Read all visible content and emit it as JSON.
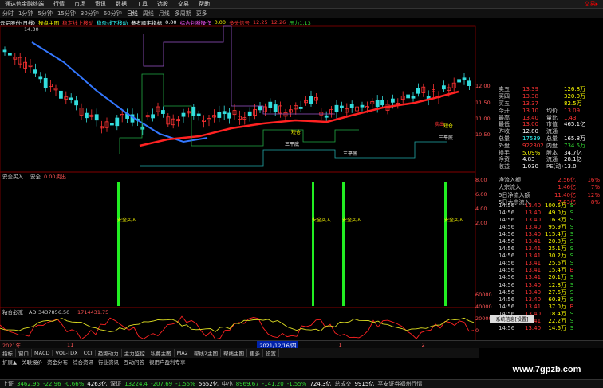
{
  "menu": {
    "items": [
      "通达信金融终端",
      "行情",
      "市场",
      "资讯",
      "数据",
      "工具",
      "选股",
      "交易",
      "帮助"
    ],
    "title": "交易▸"
  },
  "toolbar": {
    "items": [
      "分时",
      "1分钟",
      "5分钟",
      "15分钟",
      "30分钟",
      "60分钟",
      "日线",
      "周线",
      "月线",
      "多周期",
      "更多"
    ],
    "active": "日线"
  },
  "info": {
    "stock": "云铝股份(日线)",
    "indicator": "操盘主图",
    "t1": "稳定线上移动",
    "t2": "稳盈线下移动",
    "t3": "参考顺宅指标",
    "t3v": "0.00",
    "t4": "综合判断操作",
    "t5": "0.00",
    "t6": "多头信号",
    "t7": "12.25",
    "t8": "12.26",
    "t9": "压力1.13"
  },
  "price_axis": [
    "12.00",
    "11.50",
    "11.00",
    "10.50"
  ],
  "panel2": {
    "title": "安全买入",
    "label": "安全",
    "val": "0.00",
    "extra": "卖出",
    "axis": [
      "8.00",
      "6.00",
      "4.00",
      "2.00",
      "0.00"
    ],
    "buy_label": "安全买入"
  },
  "panel3": {
    "title": "粘合必涨",
    "ad": "AD",
    "ad_val": "3437856.50",
    "v2": "1714431.75",
    "axis": [
      "60000",
      "40000",
      "20000",
      "0",
      "-20000"
    ]
  },
  "quote": {
    "rows": [
      [
        "卖五",
        "13.39",
        "",
        "126.8万",
        ""
      ],
      [
        "买四",
        "13.38",
        "",
        "320.0万",
        ""
      ],
      [
        "买五",
        "13.37",
        "",
        "82.5万",
        ""
      ],
      [
        "今开",
        "13.10",
        "均价",
        "13.09",
        ""
      ],
      [
        "最高",
        "13.40",
        "量比",
        "1.43",
        ""
      ],
      [
        "最低",
        "13.00",
        "市值",
        "465.1亿",
        ""
      ],
      [
        "昨收",
        "12.80",
        "流通",
        "",
        ""
      ],
      [
        "总量",
        "17539",
        "总量",
        "165.8万",
        ""
      ],
      [
        "外盘",
        "922302",
        "内盘",
        "734.5万",
        ""
      ],
      [
        "换手",
        "5.09%",
        "股本",
        "34.7亿",
        ""
      ],
      [
        "净资",
        "4.83",
        "流通",
        "28.1亿",
        ""
      ],
      [
        "收益",
        "1.030",
        "PE(动)",
        "13.0",
        ""
      ]
    ]
  },
  "fund": [
    [
      "净流入额",
      "2.56亿",
      "16%"
    ],
    [
      "大宗流入",
      "1.46亿",
      "7%"
    ],
    [
      "5日净流入额",
      "11.40亿",
      "12%"
    ],
    [
      "5日大宗流入",
      "7.83亿",
      "8%"
    ]
  ],
  "ticks": [
    [
      "14:56",
      "13.40",
      "100.6万",
      "S"
    ],
    [
      "14:56",
      "13.40",
      "49.0万",
      "S"
    ],
    [
      "14:56",
      "13.40",
      "16.3万",
      "S"
    ],
    [
      "14:56",
      "13.40",
      "95.9万",
      "S"
    ],
    [
      "14:56",
      "13.40",
      "115.4万",
      "S"
    ],
    [
      "14:56",
      "13.41",
      "20.8万",
      "S"
    ],
    [
      "14:56",
      "13.41",
      "25.1万",
      "S"
    ],
    [
      "14:56",
      "13.41",
      "30.2万",
      "S"
    ],
    [
      "14:56",
      "13.41",
      "25.6万",
      "S"
    ],
    [
      "14:56",
      "13.41",
      "15.4万",
      "B"
    ],
    [
      "14:56",
      "13.41",
      "20.1万",
      "S"
    ],
    [
      "14:56",
      "13.40",
      "12.8万",
      "S"
    ],
    [
      "14:56",
      "13.40",
      "27.6万",
      "S"
    ],
    [
      "14:56",
      "13.40",
      "60.3万",
      "S"
    ],
    [
      "14:56",
      "13.41",
      "37.0万",
      "B"
    ],
    [
      "14:56",
      "13.40",
      "18.4万",
      "S"
    ],
    [
      "14:56",
      "13.41",
      "22.2万",
      "S"
    ],
    [
      "14:56",
      "13.40",
      "14.6万",
      "S"
    ]
  ],
  "xaxis": {
    "year": "2021年",
    "m1": "11",
    "date_box": "2021/12/16/四",
    "m2": "1",
    "m3": "2"
  },
  "tabs": [
    "指标",
    "窗口",
    "MACD",
    "VOL-TDX",
    "CCI",
    "趋势动力",
    "主力监控",
    "私募主图",
    "MA2",
    "帮线2主图",
    "帮线主图",
    "更多",
    "设置"
  ],
  "tabs2": [
    "扩展▲",
    "关联报价",
    "资金分布",
    "综合资讯",
    "行业资讯",
    "互动问答",
    "很用户盈利专享"
  ],
  "mp_label": "系统信息[设置]",
  "status": {
    "sh_name": "上证",
    "sh": "3462.95",
    "sh_ch": "-22.96",
    "sh_pct": "-0.66%",
    "sh_amt": "4263亿",
    "sz_name": "深证",
    "sz": "13224.4",
    "sz_ch": "-207.69",
    "sz_pct": "-1.55%",
    "sz_amt": "5652亿",
    "zx_name": "中小",
    "zx": "8969.67",
    "zx_ch": "-141.20",
    "zx_pct": "-1.55%",
    "zx_amt": "724.3亿",
    "total": "总成交",
    "total_amt": "9915亿",
    "broker": "平安证券福州行情"
  },
  "annotations": {
    "a1": "三平底",
    "a2": "三平底",
    "a3": "三平底",
    "sell": "卖出",
    "buy": "短仓",
    "top": "14.30"
  },
  "watermark": "www.7gpzb.com",
  "colors": {
    "up": "#ff3333",
    "down": "#33dddd",
    "ma": "#ff2222",
    "blue_line": "#3377ff",
    "green": "#22ee22"
  }
}
